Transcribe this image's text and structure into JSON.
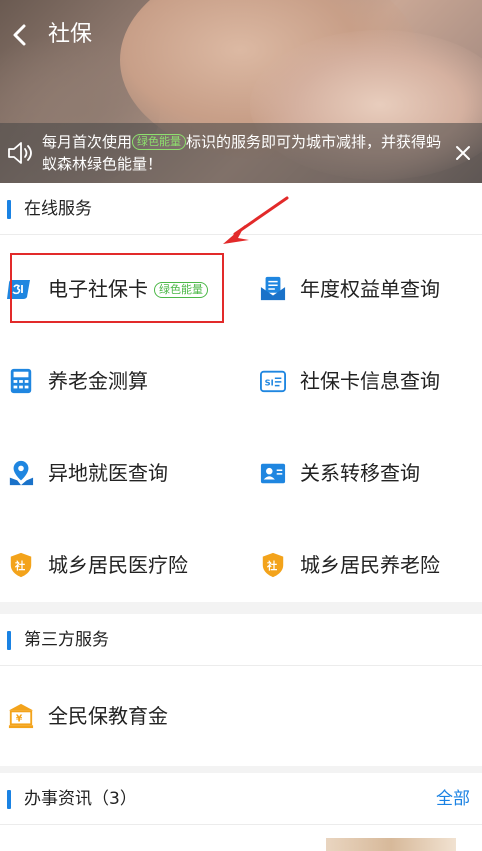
{
  "header": {
    "title": "社保",
    "back_icon": "chevron-left-icon"
  },
  "notice": {
    "text_before": "每月首次使用",
    "tag": "绿色能量",
    "text_after": "标识的服务即可为城市减排，并获得蚂蚁森林绿色能量！",
    "speaker_icon": "speaker-icon",
    "close_icon": "close-icon"
  },
  "online": {
    "heading": "在线服务",
    "items": [
      {
        "label": "电子社保卡",
        "icon": "e-card-icon",
        "tag": "绿色能量"
      },
      {
        "label": "年度权益单查询",
        "icon": "mail-document-icon"
      },
      {
        "label": "养老金测算",
        "icon": "calculator-icon"
      },
      {
        "label": "社保卡信息查询",
        "icon": "si-card-icon"
      },
      {
        "label": "异地就医查询",
        "icon": "location-person-icon"
      },
      {
        "label": "关系转移查询",
        "icon": "id-card-icon"
      },
      {
        "label": "城乡居民医疗险",
        "icon": "shield-she-icon"
      },
      {
        "label": "城乡居民养老险",
        "icon": "shield-she-icon"
      }
    ]
  },
  "third_party": {
    "heading": "第三方服务",
    "items": [
      {
        "label": "全民保教育金",
        "icon": "bank-yen-icon"
      }
    ]
  },
  "news": {
    "heading": "办事资讯（3）",
    "more_label": "全部"
  },
  "colors": {
    "accent": "#1a82e3",
    "green_tag": "#4cb848",
    "annotation_red": "#e22a2a",
    "shield_orange": "#f3a31b"
  }
}
